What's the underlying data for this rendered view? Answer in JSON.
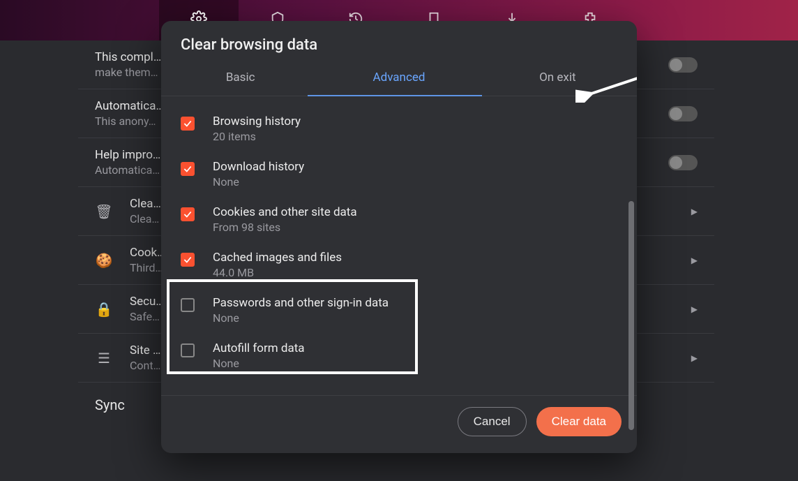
{
  "dialog": {
    "title": "Clear browsing data",
    "tabs": {
      "basic": "Basic",
      "advanced": "Advanced",
      "onexit": "On exit"
    },
    "options": [
      {
        "label": "Browsing history",
        "sub": "20 items",
        "checked": true
      },
      {
        "label": "Download history",
        "sub": "None",
        "checked": true
      },
      {
        "label": "Cookies and other site data",
        "sub": "From 98 sites",
        "checked": true
      },
      {
        "label": "Cached images and files",
        "sub": "44.0 MB",
        "checked": true
      },
      {
        "label": "Passwords and other sign-in data",
        "sub": "None",
        "checked": false
      },
      {
        "label": "Autofill form data",
        "sub": "None",
        "checked": false
      }
    ],
    "buttons": {
      "cancel": "Cancel",
      "clear": "Clear data"
    }
  },
  "bg": {
    "row0": {
      "title": "This compl…",
      "sub": "make them…"
    },
    "row1": {
      "title": "Automatica…",
      "sub": "This anony…"
    },
    "row2": {
      "title": "Help impro…",
      "sub": "Automatica…"
    },
    "row3": {
      "title": "Clea…",
      "sub": "Clea…"
    },
    "row4": {
      "title": "Cook…",
      "sub": "Third…"
    },
    "row5": {
      "title": "Secu…",
      "sub": "Safe…"
    },
    "row6": {
      "title": "Site …",
      "sub": "Cont…"
    },
    "section": "Sync"
  }
}
